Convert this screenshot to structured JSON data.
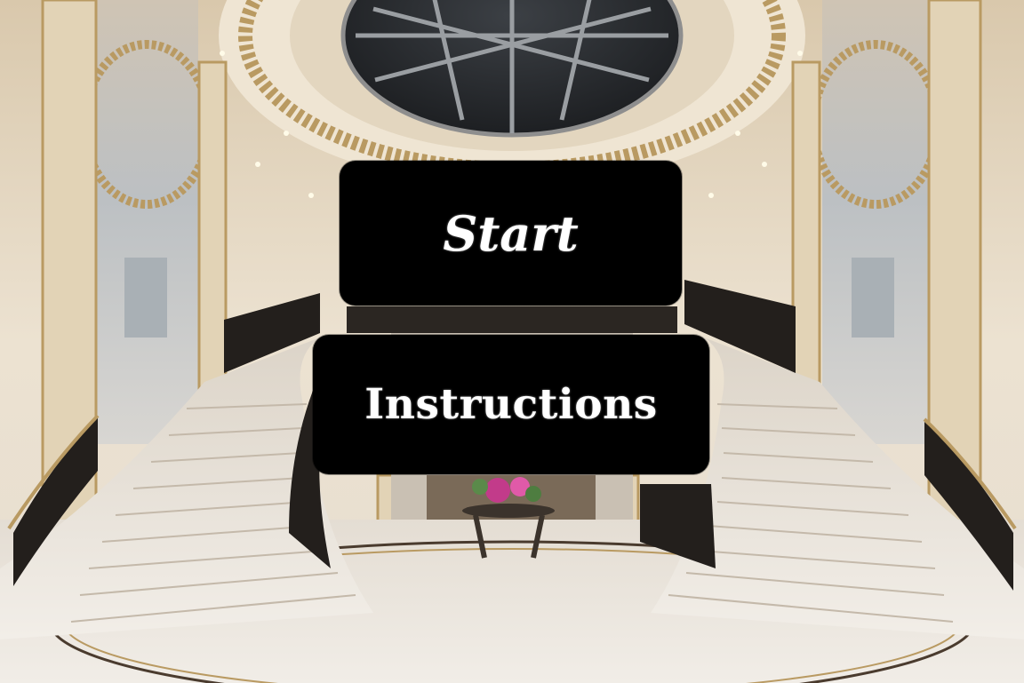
{
  "menu": {
    "start_label": "Start",
    "instructions_label": "Instructions"
  },
  "background": {
    "scene": "grand foyer with twin curved marble staircases and domed skylight",
    "colors": {
      "wall": "#e7dccb",
      "gold_trim": "#b99a62",
      "marble": "#ece7df",
      "skylight": "#2a2d31",
      "railing": "#231f1c",
      "button": "#000000",
      "button_text": "#ffffff"
    }
  }
}
